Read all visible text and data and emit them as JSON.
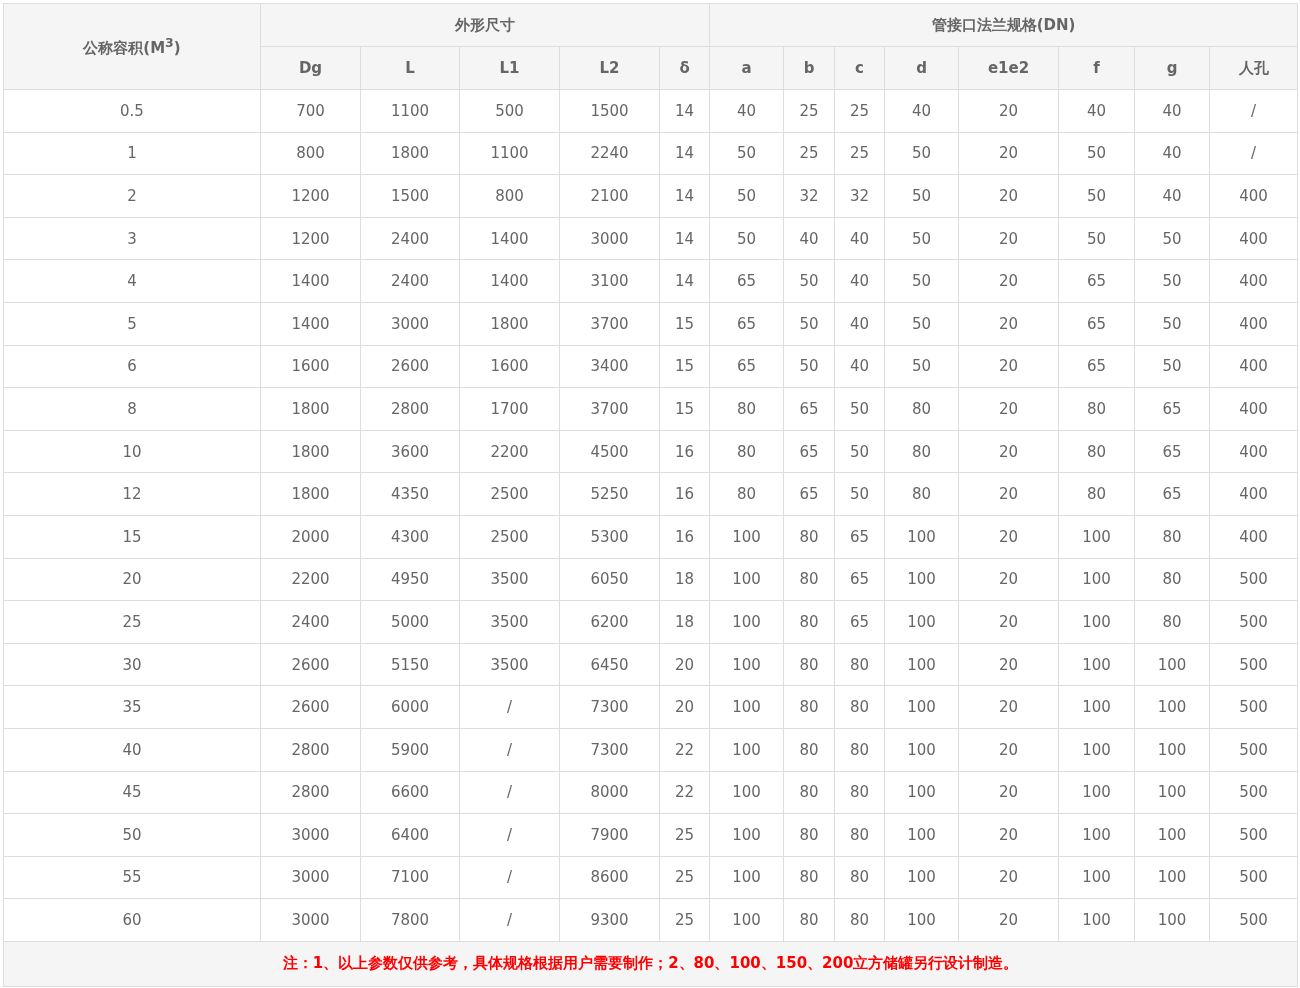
{
  "table": {
    "corner_header": "公称容积(M$^{3}$)",
    "column_groups": [
      {
        "label": "外形尺寸",
        "columns": [
          "Dg",
          "L",
          "L1",
          "L2",
          "δ"
        ]
      },
      {
        "label": "管接口法兰规格(DN)",
        "columns": [
          "a",
          "b",
          "c",
          "d",
          "e1e2",
          "f",
          "g",
          "人孔"
        ]
      }
    ],
    "rows": [
      [
        "0.5",
        "700",
        "1100",
        "500",
        "1500",
        "14",
        "40",
        "25",
        "25",
        "40",
        "20",
        "40",
        "40",
        "/"
      ],
      [
        "1",
        "800",
        "1800",
        "1100",
        "2240",
        "14",
        "50",
        "25",
        "25",
        "50",
        "20",
        "50",
        "40",
        "/"
      ],
      [
        "2",
        "1200",
        "1500",
        "800",
        "2100",
        "14",
        "50",
        "32",
        "32",
        "50",
        "20",
        "50",
        "40",
        "400"
      ],
      [
        "3",
        "1200",
        "2400",
        "1400",
        "3000",
        "14",
        "50",
        "40",
        "40",
        "50",
        "20",
        "50",
        "50",
        "400"
      ],
      [
        "4",
        "1400",
        "2400",
        "1400",
        "3100",
        "14",
        "65",
        "50",
        "40",
        "50",
        "20",
        "65",
        "50",
        "400"
      ],
      [
        "5",
        "1400",
        "3000",
        "1800",
        "3700",
        "15",
        "65",
        "50",
        "40",
        "50",
        "20",
        "65",
        "50",
        "400"
      ],
      [
        "6",
        "1600",
        "2600",
        "1600",
        "3400",
        "15",
        "65",
        "50",
        "40",
        "50",
        "20",
        "65",
        "50",
        "400"
      ],
      [
        "8",
        "1800",
        "2800",
        "1700",
        "3700",
        "15",
        "80",
        "65",
        "50",
        "80",
        "20",
        "80",
        "65",
        "400"
      ],
      [
        "10",
        "1800",
        "3600",
        "2200",
        "4500",
        "16",
        "80",
        "65",
        "50",
        "80",
        "20",
        "80",
        "65",
        "400"
      ],
      [
        "12",
        "1800",
        "4350",
        "2500",
        "5250",
        "16",
        "80",
        "65",
        "50",
        "80",
        "20",
        "80",
        "65",
        "400"
      ],
      [
        "15",
        "2000",
        "4300",
        "2500",
        "5300",
        "16",
        "100",
        "80",
        "65",
        "100",
        "20",
        "100",
        "80",
        "400"
      ],
      [
        "20",
        "2200",
        "4950",
        "3500",
        "6050",
        "18",
        "100",
        "80",
        "65",
        "100",
        "20",
        "100",
        "80",
        "500"
      ],
      [
        "25",
        "2400",
        "5000",
        "3500",
        "6200",
        "18",
        "100",
        "80",
        "65",
        "100",
        "20",
        "100",
        "80",
        "500"
      ],
      [
        "30",
        "2600",
        "5150",
        "3500",
        "6450",
        "20",
        "100",
        "80",
        "80",
        "100",
        "20",
        "100",
        "100",
        "500"
      ],
      [
        "35",
        "2600",
        "6000",
        "/",
        "7300",
        "20",
        "100",
        "80",
        "80",
        "100",
        "20",
        "100",
        "100",
        "500"
      ],
      [
        "40",
        "2800",
        "5900",
        "/",
        "7300",
        "22",
        "100",
        "80",
        "80",
        "100",
        "20",
        "100",
        "100",
        "500"
      ],
      [
        "45",
        "2800",
        "6600",
        "/",
        "8000",
        "22",
        "100",
        "80",
        "80",
        "100",
        "20",
        "100",
        "100",
        "500"
      ],
      [
        "50",
        "3000",
        "6400",
        "/",
        "7900",
        "25",
        "100",
        "80",
        "80",
        "100",
        "20",
        "100",
        "100",
        "500"
      ],
      [
        "55",
        "3000",
        "7100",
        "/",
        "8600",
        "25",
        "100",
        "80",
        "80",
        "100",
        "20",
        "100",
        "100",
        "500"
      ],
      [
        "60",
        "3000",
        "7800",
        "/",
        "9300",
        "25",
        "100",
        "80",
        "80",
        "100",
        "20",
        "100",
        "100",
        "500"
      ]
    ],
    "note": "注：1、以上参数仅供参考，具体规格根据用户需要制作；2、80、100、150、200立方储罐另行设计制造。"
  }
}
